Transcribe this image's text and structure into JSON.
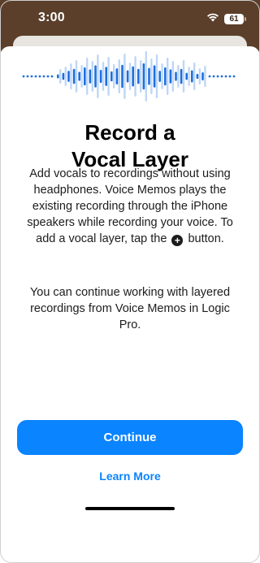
{
  "status_bar": {
    "time": "3:00",
    "battery_level": "61",
    "icons": [
      "wifi-icon",
      "battery-icon"
    ]
  },
  "intro": {
    "title_line1": "Record a",
    "title_line2": "Vocal Layer",
    "paragraph1_part1": "Add vocals to recordings without using headphones. Voice Memos plays the existing recording through the iPhone speakers while recording your voice. To add a vocal layer, tap the",
    "paragraph1_part2": "button.",
    "plus_icon": "plus-circle-icon",
    "paragraph2": "You can continue working with layered recordings from Voice Memos in Logic Pro."
  },
  "actions": {
    "continue_label": "Continue",
    "learn_more_label": "Learn More"
  },
  "colors": {
    "accent": "#0a84ff",
    "waveform_dark": "#1d6fe0",
    "waveform_light": "#bfd7f7",
    "wallpaper": "#5b3f2a"
  }
}
